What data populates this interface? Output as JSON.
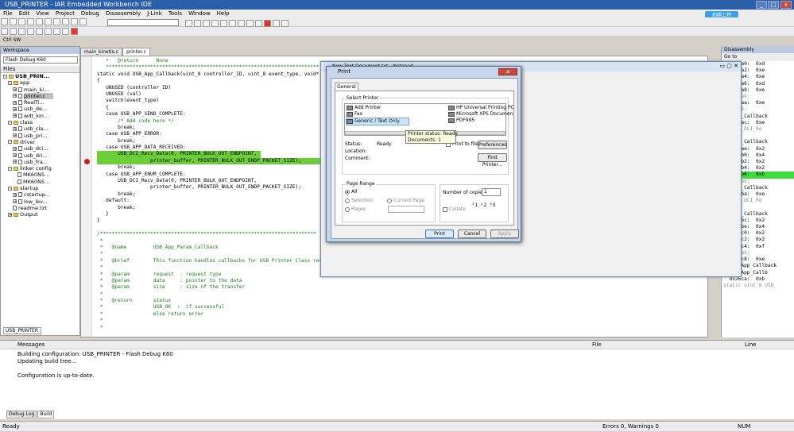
{
  "window": {
    "title": "USB_PRINTER - IAR Embedded Workbench IDE"
  },
  "menu": [
    "File",
    "Edit",
    "View",
    "Project",
    "Debug",
    "Disassembly",
    "J-Link",
    "Tools",
    "Window",
    "Help"
  ],
  "cloud_button": "拍照上传",
  "toolbar2_label": "Ctrl  SW",
  "workspace": {
    "header": "Workspace",
    "config": "Flash Debug K60",
    "files_label": "Files",
    "tree": [
      "USB_PRIN...",
      "app",
      "main_ki...",
      "printer.c",
      "RealTi...",
      "usb_de...",
      "wdt_kin...",
      "class",
      "usb_cla...",
      "usb_pri...",
      "driver",
      "usb_dci...",
      "usb_dri...",
      "usb_fra...",
      "linker config",
      "MK60N5...",
      "MK60N5...",
      "startup",
      "cstartup...",
      "low_lev...",
      "readme.txt",
      "Output"
    ],
    "bottom_tab": "USB_PRINTER"
  },
  "editor": {
    "tabs": [
      "main_kinetis.c",
      "printer.c"
    ],
    "lines": [
      "   *   @return      None",
      "   ************************************************************************",
      "static void USB_App_Callback(uint_8 controller_ID, uint_8 event_type, void* va",
      "{",
      "   UNUSED (controller_ID)",
      "   UNUSED (val)",
      "   switch(event_type)",
      "   {",
      "   case USB_APP_SEND_COMPLETE:",
      "       /* Add code here */",
      "       break;",
      "   case USB_APP_ERROR:",
      "       break;",
      "   case USB_APP_DATA_RECEIVED:",
      "       USB_DCI_Recv_Data(0, PRINTER_BULK_OUT_ENDPOINT,",
      "                  printer_buffer, PRINTER_BULK_OUT_ENDP_PACKET_SIZE);",
      "       break;",
      "   case USB_APP_ENUM_COMPLETE:",
      "       USB_DCI_Recv_Data(0, PRINTER_BULK_OUT_ENDPOINT,",
      "                  printer_buffer, PRINTER_BULK_OUT_ENDP_PACKET_SIZE);",
      "       break;",
      "   default:",
      "       break;",
      "   }",
      "}",
      "",
      "/*************************************************************************",
      " *",
      " *   @name         USB_App_Param_Callback",
      " *",
      " *   @brief        This function handles callbacks for USB Printer Class reque",
      " *",
      " *   @param        request  : request type",
      " *   @param        data     : pointer to the data",
      " *   @param        size     : size of the transfer",
      " *",
      " *   @return       status",
      " *                 USB_OK  :  if successful",
      " *                 else return error",
      " *",
      " *"
    ]
  },
  "disassembly": {
    "header": "Disassembly",
    "goto": "Go to",
    "lines": [
      "  0x26a0:  0xd",
      "  0x26a2:  0xe",
      "  0x26a4:  0xe",
      "  0x26a6:  0xd",
      "  0x26a8:  0xe",
      "   break;",
      "  0x26aa:  0xe",
      "  break;",
      "  _App_Callback",
      "  0x26ac:  0xe",
      "   USB_DCI_Re",
      "",
      "  _App_Callback",
      "  0x26ae:  0x2",
      "  0x26b0:  0x4",
      "  0x26b2:  0x2",
      "  0x26b4:  0x2",
      "  0x26b6:  0xb",
      "   break;",
      "  _App_Callback",
      "  0x26ba:  0xe",
      "   USB_DCI_Re",
      "",
      "  _App_Callback",
      "  0x26bc:  0x2",
      "  0x26be:  0x4",
      "  0x26c0:  0x2",
      "  0x26c2:  0x2",
      "  0x26c4:  0xf",
      "   break;",
      "  0x26c8:  0xe",
      "??USB_App_Callback",
      "??USB_App_Callb",
      "  0x26ca:  0xb",
      "static uint_8 USB_"
    ]
  },
  "notepad": {
    "title": "New Text Document.txt - Notepad"
  },
  "print_dialog": {
    "title": "Print",
    "close": "✕",
    "tab": "General",
    "select_printer": "Select Printer",
    "printers_left": [
      "Add Printer",
      "Fax",
      "Generic / Text Only"
    ],
    "printers_right": [
      "HP Universal Printing PC",
      "Microsoft XPS Documen",
      "PDF995"
    ],
    "status_label": "Status:",
    "status_value": "Ready",
    "location_label": "Location:",
    "comment_label": "Comment:",
    "print_to_file": "Print to file",
    "preferences": "Preferences",
    "find_printer": "Find Printer...",
    "page_range": "Page Range",
    "all": "All",
    "selection": "Selection",
    "current_page": "Current Page",
    "pages": "Pages:",
    "copies_label": "Number of copies:",
    "copies_value": "1",
    "collate": "Collate",
    "print_btn": "Print",
    "cancel_btn": "Cancel",
    "apply_btn": "Apply",
    "tooltip_line1": "Printer status: Ready",
    "tooltip_line2": "Documents: 1"
  },
  "messages": {
    "header": "Messages",
    "file_col": "File",
    "line_col": "Line",
    "lines": [
      "Building configuration: USB_PRINTER - Flash Debug K60",
      "Updating build tree...",
      "",
      "Configuration is up-to-date."
    ]
  },
  "bottom_tabs": [
    "Debug Log",
    "Build"
  ],
  "status": {
    "left": "Ready",
    "errors": "Errors 0, Warnings 0",
    "num": "NUM"
  }
}
